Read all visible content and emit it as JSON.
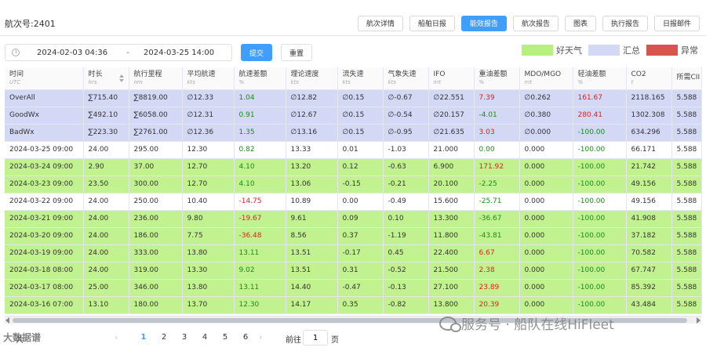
{
  "header": {
    "voyage_title": "航次号:2401",
    "tabs": [
      "航次详情",
      "船舶日报",
      "能效报告",
      "航次报告",
      "图表",
      "执行报告",
      "日报邮件"
    ],
    "active_tab": "能效报告"
  },
  "filters": {
    "date_start": "2024-02-03 04:36",
    "date_separator": "-",
    "date_end": "2024-03-25 14:00",
    "submit_label": "提交",
    "reset_label": "重置"
  },
  "legend": [
    {
      "label": "好天气",
      "color": "#b8f080"
    },
    {
      "label": "汇总",
      "color": "#d3d8f5"
    },
    {
      "label": "异常",
      "color": "#d9534f"
    }
  ],
  "table": {
    "columns": [
      {
        "name": "时间",
        "unit": "UTC"
      },
      {
        "name": "时长",
        "unit": "hrs"
      },
      {
        "name": "航行里程",
        "unit": "nm"
      },
      {
        "name": "平均航速",
        "unit": "kts"
      },
      {
        "name": "航速差额",
        "unit": "%"
      },
      {
        "name": "理论速度",
        "unit": "kts"
      },
      {
        "name": "流失速",
        "unit": "kts"
      },
      {
        "name": "气象失速",
        "unit": "kts"
      },
      {
        "name": "IFO",
        "unit": "mt"
      },
      {
        "name": "重油差额",
        "unit": "%"
      },
      {
        "name": "MDO/MGO",
        "unit": "mt"
      },
      {
        "name": "轻油差额",
        "unit": "%"
      },
      {
        "name": "CO2",
        "unit": "t"
      },
      {
        "name": "所需CII",
        "unit": ""
      }
    ],
    "rows": [
      {
        "type": "summary",
        "cells": [
          "OverAll",
          "∑715.40",
          "∑8819.00",
          "∅12.33",
          "1.04",
          "∅12.82",
          "∅0.15",
          "∅-0.67",
          "∅22.551",
          "7.39",
          "∅0.262",
          "161.67",
          "2118.165",
          "5.588"
        ],
        "neg": [
          9,
          11
        ],
        "pos": [
          4
        ]
      },
      {
        "type": "summary",
        "cells": [
          "GoodWx",
          "∑492.10",
          "∑6058.00",
          "∅12.31",
          "0.91",
          "∅12.67",
          "∅0.15",
          "∅-0.54",
          "∅20.157",
          "-4.01",
          "∅0.380",
          "280.41",
          "1302.308",
          "5.588"
        ],
        "neg": [
          11
        ],
        "pos": [
          4,
          9
        ]
      },
      {
        "type": "summary",
        "cells": [
          "BadWx",
          "∑223.30",
          "∑2761.00",
          "∅12.36",
          "1.35",
          "∅13.16",
          "∅0.15",
          "∅-0.95",
          "∅21.635",
          "3.03",
          "∅0.000",
          "-100.00",
          "634.296",
          "5.588"
        ],
        "neg": [
          9
        ],
        "pos": [
          4,
          11
        ]
      },
      {
        "type": "bad",
        "cells": [
          "2024-03-25 09:00",
          "24.00",
          "295.00",
          "12.30",
          "0.82",
          "13.33",
          "0.01",
          "-1.03",
          "21.000",
          "0.00",
          "0.000",
          "-100.00",
          "66.171",
          "5.588"
        ],
        "neg": [],
        "pos": [
          4,
          9,
          11
        ]
      },
      {
        "type": "good",
        "cells": [
          "2024-03-24 09:00",
          "2.90",
          "37.00",
          "12.70",
          "4.10",
          "13.20",
          "0.12",
          "-0.63",
          "6.900",
          "171.92",
          "0.000",
          "-100.00",
          "21.742",
          "5.588"
        ],
        "neg": [
          9
        ],
        "pos": [
          4,
          11
        ]
      },
      {
        "type": "good",
        "cells": [
          "2024-03-23 09:00",
          "23.50",
          "300.00",
          "12.70",
          "4.10",
          "13.06",
          "-0.15",
          "-0.21",
          "20.100",
          "-2.25",
          "0.000",
          "-100.00",
          "49.156",
          "5.588"
        ],
        "neg": [],
        "pos": [
          4,
          9,
          11
        ]
      },
      {
        "type": "bad",
        "cells": [
          "2024-03-22 09:00",
          "24.00",
          "250.00",
          "10.40",
          "-14.75",
          "10.89",
          "0.00",
          "-0.49",
          "15.600",
          "-25.71",
          "0.000",
          "-100.00",
          "49.156",
          "5.588"
        ],
        "neg": [
          4
        ],
        "pos": [
          9,
          11
        ]
      },
      {
        "type": "good",
        "cells": [
          "2024-03-21 09:00",
          "24.00",
          "236.00",
          "9.80",
          "-19.67",
          "9.61",
          "0.09",
          "0.10",
          "13.300",
          "-36.67",
          "0.000",
          "-100.00",
          "41.908",
          "5.588"
        ],
        "neg": [
          4
        ],
        "pos": [
          9,
          11
        ]
      },
      {
        "type": "good",
        "cells": [
          "2024-03-20 09:00",
          "24.00",
          "186.00",
          "7.75",
          "-36.48",
          "8.56",
          "0.37",
          "-1.19",
          "11.800",
          "-43.81",
          "0.000",
          "-100.00",
          "37.182",
          "5.588"
        ],
        "neg": [
          4
        ],
        "pos": [
          9,
          11
        ]
      },
      {
        "type": "good",
        "cells": [
          "2024-03-19 09:00",
          "24.00",
          "333.00",
          "13.80",
          "13.11",
          "13.51",
          "-0.17",
          "0.45",
          "22.400",
          "6.67",
          "0.000",
          "-100.00",
          "70.582",
          "5.588"
        ],
        "neg": [
          9
        ],
        "pos": [
          4,
          11
        ]
      },
      {
        "type": "good",
        "cells": [
          "2024-03-18 08:00",
          "24.00",
          "319.00",
          "13.30",
          "9.02",
          "13.51",
          "0.31",
          "-0.52",
          "21.500",
          "2.38",
          "0.000",
          "-100.00",
          "67.747",
          "5.588"
        ],
        "neg": [
          9
        ],
        "pos": [
          4,
          11
        ]
      },
      {
        "type": "good",
        "cells": [
          "2024-03-17 08:00",
          "25.00",
          "346.00",
          "13.80",
          "13.11",
          "14.40",
          "-0.47",
          "-0.13",
          "27.100",
          "23.89",
          "0.000",
          "-100.00",
          "85.392",
          "5.588"
        ],
        "neg": [
          9
        ],
        "pos": [
          4,
          11
        ]
      },
      {
        "type": "good",
        "cells": [
          "2024-03-16 07:00",
          "13.10",
          "180.00",
          "13.70",
          "12.30",
          "14.17",
          "0.35",
          "-0.82",
          "13.800",
          "20.39",
          "0.000",
          "-100.00",
          "43.484",
          "5.588"
        ],
        "neg": [
          9
        ],
        "pos": [
          4,
          11
        ]
      }
    ]
  },
  "pagination": {
    "total_label": "共",
    "pages": [
      "1",
      "2",
      "3",
      "4",
      "5",
      "6"
    ],
    "current_page": "1",
    "prev_icon": "‹",
    "next_icon": "›",
    "goto_label": "前往",
    "goto_value": "1",
    "goto_suffix": "页"
  },
  "watermark": {
    "text": "服务号 · 船队在线HiFleet",
    "text2": "大数据谱"
  }
}
